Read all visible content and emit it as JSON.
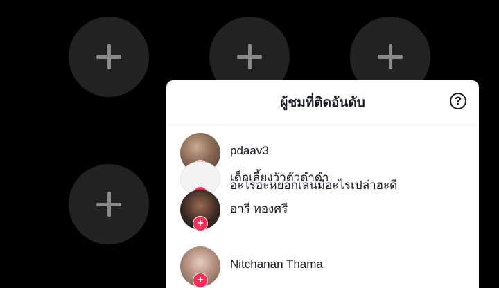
{
  "background_slots": {
    "icon": "plus-icon",
    "count": 5
  },
  "panel": {
    "title": "ผู้ชมที่ติดอันดับ",
    "help_symbol": "?",
    "help_icon": "help-circle-icon"
  },
  "viewers": [
    {
      "name": "pdaav3"
    },
    {
      "name": "เด็กเลี้ยงวัวตัวดำดำ"
    },
    {
      "name": "อะไรอะหยอกเล่นมีอะไรเปล่าฮะดี"
    },
    {
      "name": "อารี ทองศรี"
    },
    {
      "name": "Nitchanan Thama"
    }
  ],
  "badge_symbol": "+",
  "colors": {
    "background": "#000000",
    "slot": "#222222",
    "accent": "#fe2c55",
    "panel": "#ffffff"
  }
}
